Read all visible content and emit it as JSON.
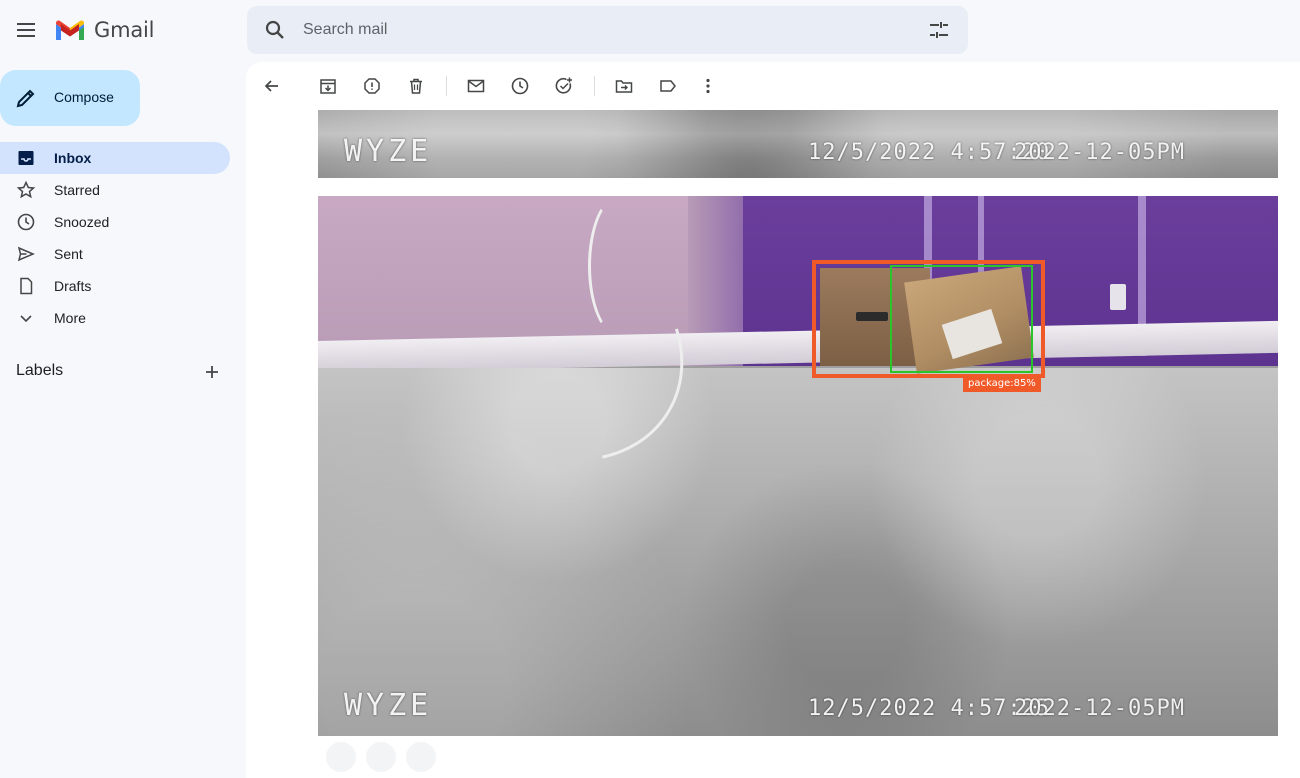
{
  "app": {
    "name": "Gmail",
    "brand_colors": {
      "red": "#ea4335",
      "blue": "#4285f4",
      "green": "#34a853",
      "yellow": "#fbbc04"
    },
    "menu_icon": "hamburger-menu-icon"
  },
  "search": {
    "placeholder": "Search mail",
    "icon": "search-icon",
    "options_icon": "tune-icon"
  },
  "compose": {
    "label": "Compose",
    "icon": "pencil-icon"
  },
  "sidebar": {
    "items": [
      {
        "label": "Inbox",
        "icon": "inbox-icon",
        "active": true
      },
      {
        "label": "Starred",
        "icon": "star-icon",
        "active": false
      },
      {
        "label": "Snoozed",
        "icon": "clock-icon",
        "active": false
      },
      {
        "label": "Sent",
        "icon": "send-icon",
        "active": false
      },
      {
        "label": "Drafts",
        "icon": "draft-icon",
        "active": false
      },
      {
        "label": "More",
        "icon": "chevron-down-icon",
        "active": false
      }
    ],
    "labels_header": "Labels",
    "labels_add_icon": "plus-icon"
  },
  "toolbar": {
    "buttons": [
      "back-arrow-icon",
      "archive-icon",
      "report-spam-icon",
      "delete-icon",
      "mark-unread-icon",
      "snooze-icon",
      "add-task-icon",
      "move-to-icon",
      "label-icon",
      "more-vert-icon"
    ]
  },
  "email": {
    "frames": [
      {
        "brand": "WYZE",
        "timestamp": "12/5/2022 4:57:20",
        "overlay_text": "2022-12-05PM"
      },
      {
        "brand": "WYZE",
        "timestamp": "12/5/2022 4:57:25",
        "overlay_text": "2022-12-05PM",
        "detection": {
          "label": "package:85%",
          "color": "#f05a28",
          "secondary_color": "#29c52b"
        }
      }
    ]
  }
}
